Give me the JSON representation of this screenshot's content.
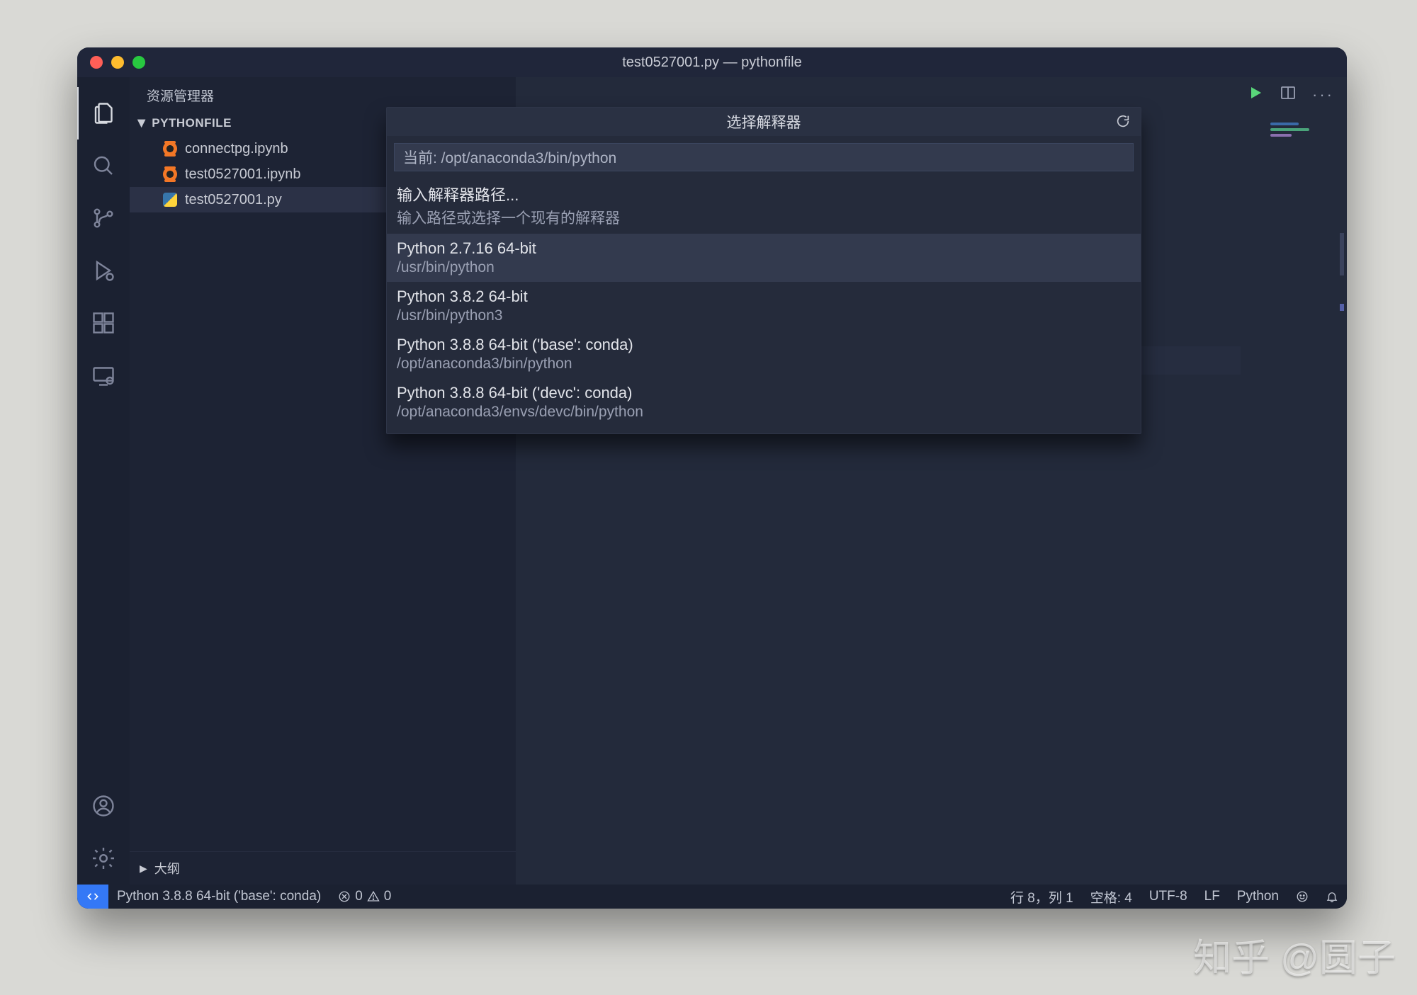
{
  "window": {
    "title": "test0527001.py — pythonfile"
  },
  "sidebar": {
    "title": "资源管理器",
    "folder": "PYTHONFILE",
    "files": [
      {
        "name": "connectpg.ipynb",
        "iconType": "jupyter"
      },
      {
        "name": "test0527001.ipynb",
        "iconType": "jupyter"
      },
      {
        "name": "test0527001.py",
        "iconType": "python"
      }
    ],
    "outline": "大纲"
  },
  "quickpick": {
    "title": "选择解释器",
    "inputPrefix": "当前: /opt/anaconda3/bin/python",
    "enterPath": {
      "line1": "输入解释器路径...",
      "line2": "输入路径或选择一个现有的解释器"
    },
    "options": [
      {
        "line1": "Python 2.7.16 64-bit",
        "line2": "/usr/bin/python",
        "highlight": true
      },
      {
        "line1": "Python 3.8.2 64-bit",
        "line2": "/usr/bin/python3"
      },
      {
        "line1": "Python 3.8.8 64-bit ('base': conda)",
        "line2": "/opt/anaconda3/bin/python"
      },
      {
        "line1": "Python 3.8.8 64-bit ('devc': conda)",
        "line2": "/opt/anaconda3/envs/devc/bin/python"
      }
    ]
  },
  "statusbar": {
    "interpreter": "Python 3.8.8 64-bit ('base': conda)",
    "errors": "0",
    "warnings": "0",
    "cursor": "行 8，列 1",
    "indent": "空格: 4",
    "encoding": "UTF-8",
    "eol": "LF",
    "language": "Python"
  },
  "watermark": "知乎 @圆子"
}
